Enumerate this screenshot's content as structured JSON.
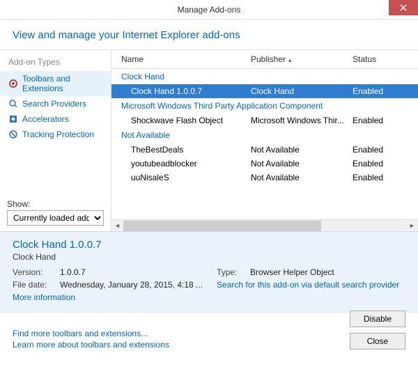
{
  "titlebar": {
    "title": "Manage Add-ons"
  },
  "header": {
    "text": "View and manage your Internet Explorer add-ons"
  },
  "sidebar": {
    "title": "Add-on Types",
    "items": [
      {
        "label": "Toolbars and Extensions"
      },
      {
        "label": "Search Providers"
      },
      {
        "label": "Accelerators"
      },
      {
        "label": "Tracking Protection"
      }
    ],
    "show_label": "Show:",
    "show_value": "Currently loaded add-ons"
  },
  "columns": {
    "name": "Name",
    "publisher": "Publisher",
    "status": "Status"
  },
  "groups": [
    {
      "title": "Clock Hand",
      "rows": [
        {
          "name": "Clock Hand 1.0.0.7",
          "publisher": "Clock Hand",
          "status": "Enabled",
          "selected": true
        }
      ]
    },
    {
      "title": "Microsoft Windows Third Party Application Component",
      "rows": [
        {
          "name": "Shockwave Flash Object",
          "publisher": "Microsoft Windows Thir...",
          "status": "Enabled"
        }
      ]
    },
    {
      "title": "Not Available",
      "rows": [
        {
          "name": "TheBestDeals",
          "publisher": "Not Available",
          "status": "Enabled"
        },
        {
          "name": "youtubeadblocker",
          "publisher": "Not Available",
          "status": "Enabled"
        },
        {
          "name": "uuNisaleS",
          "publisher": "Not Available",
          "status": "Enabled"
        }
      ]
    }
  ],
  "details": {
    "title": "Clock Hand 1.0.0.7",
    "subtitle": "Clock Hand",
    "version_label": "Version:",
    "version": "1.0.0.7",
    "filedate_label": "File date:",
    "filedate": "Wednesday, January 28, 2015, 4:18 ...",
    "type_label": "Type:",
    "type": "Browser Helper Object",
    "search_link": "Search for this add-on via default search provider",
    "more_info": "More information"
  },
  "footer": {
    "link1": "Find more toolbars and extensions...",
    "link2": "Learn more about toolbars and extensions",
    "disable": "Disable",
    "close": "Close"
  }
}
